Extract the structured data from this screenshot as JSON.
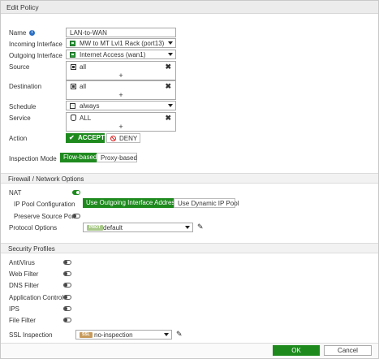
{
  "dialog": {
    "title": "Edit Policy"
  },
  "form": {
    "name_label": "Name",
    "name_value": "LAN-to-WAN",
    "incoming_label": "Incoming Interface",
    "incoming_value": "MW to MT Lvl1 Rack (port13)",
    "outgoing_label": "Outgoing Interface",
    "outgoing_value": "Internet Access (wan1)",
    "source_label": "Source",
    "source_value": "all",
    "destination_label": "Destination",
    "destination_value": "all",
    "schedule_label": "Schedule",
    "schedule_value": "always",
    "service_label": "Service",
    "service_value": "ALL",
    "action_label": "Action",
    "accept_label": "ACCEPT",
    "deny_label": "DENY",
    "inspection_label": "Inspection Mode",
    "inspection_options": [
      "Flow-based",
      "Proxy-based"
    ],
    "inspection_selected": "Flow-based"
  },
  "firewall": {
    "section_title": "Firewall / Network Options",
    "nat_label": "NAT",
    "nat_enabled": true,
    "ip_pool_label": "IP Pool Configuration",
    "ip_pool_options": [
      "Use Outgoing Interface Address",
      "Use Dynamic IP Pool"
    ],
    "ip_pool_selected": "Use Outgoing Interface Address",
    "preserve_label": "Preserve Source Port",
    "preserve_enabled": false,
    "protocol_label": "Protocol Options",
    "protocol_badge": "PROT",
    "protocol_value": "default"
  },
  "security": {
    "section_title": "Security Profiles",
    "profiles": [
      {
        "label": "AntiVirus",
        "enabled": false
      },
      {
        "label": "Web Filter",
        "enabled": false
      },
      {
        "label": "DNS Filter",
        "enabled": false
      },
      {
        "label": "Application Control",
        "enabled": false
      },
      {
        "label": "IPS",
        "enabled": false
      },
      {
        "label": "File Filter",
        "enabled": false
      }
    ],
    "ssl_label": "SSL Inspection",
    "ssl_badge": "SSL",
    "ssl_value": "no-inspection"
  },
  "footer": {
    "ok_label": "OK",
    "cancel_label": "Cancel"
  },
  "colors": {
    "accent": "#1e8a1e",
    "ssl_badge": "#c89a5a",
    "prot_badge": "#a9c98a",
    "info": "#2a6fc4"
  },
  "icons": {
    "info": "info-icon",
    "interface": "port-icon",
    "address": "address-icon",
    "service": "service-icon",
    "remove": "remove-icon",
    "add": "plus-icon",
    "edit": "pencil-icon"
  }
}
